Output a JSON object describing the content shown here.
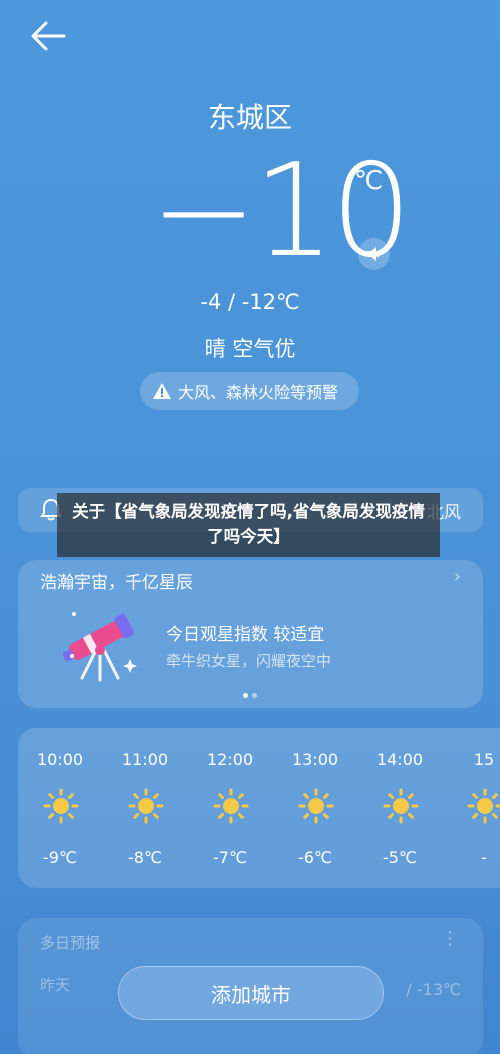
{
  "header": {
    "city": "东城区"
  },
  "current": {
    "temperature": "−10",
    "unit": "℃",
    "range": "-4 / -12℃",
    "condition": "晴  空气优",
    "alert": "大风、森林火险等预警"
  },
  "strip": {
    "wind": "北风"
  },
  "news_overlay": {
    "text": "关于【省气象局发现疫情了吗,省气象局发现疫情了吗今天】"
  },
  "astro_card": {
    "title": "浩瀚宇宙，千亿星辰",
    "chevron": "›",
    "index_label": "今日观星指数  较适宜",
    "subtitle": "牵牛织女星，闪耀夜空中"
  },
  "hourly": [
    {
      "time": "10:00",
      "temp": "-9℃",
      "icon": "sun-icon"
    },
    {
      "time": "11:00",
      "temp": "-8℃",
      "icon": "sun-icon"
    },
    {
      "time": "12:00",
      "temp": "-7℃",
      "icon": "sun-icon"
    },
    {
      "time": "13:00",
      "temp": "-6℃",
      "icon": "sun-icon"
    },
    {
      "time": "14:00",
      "temp": "-5℃",
      "icon": "sun-icon"
    },
    {
      "time": "15",
      "temp": "-",
      "icon": "sun-icon"
    }
  ],
  "multi_day": {
    "title": "多日预报",
    "more": "⋮",
    "first_day": "昨天",
    "first_right": "/ -13℃"
  },
  "add_city_label": "添加城市",
  "colors": {
    "sun": "#f7c948",
    "accent_pink": "#e94d8f"
  }
}
